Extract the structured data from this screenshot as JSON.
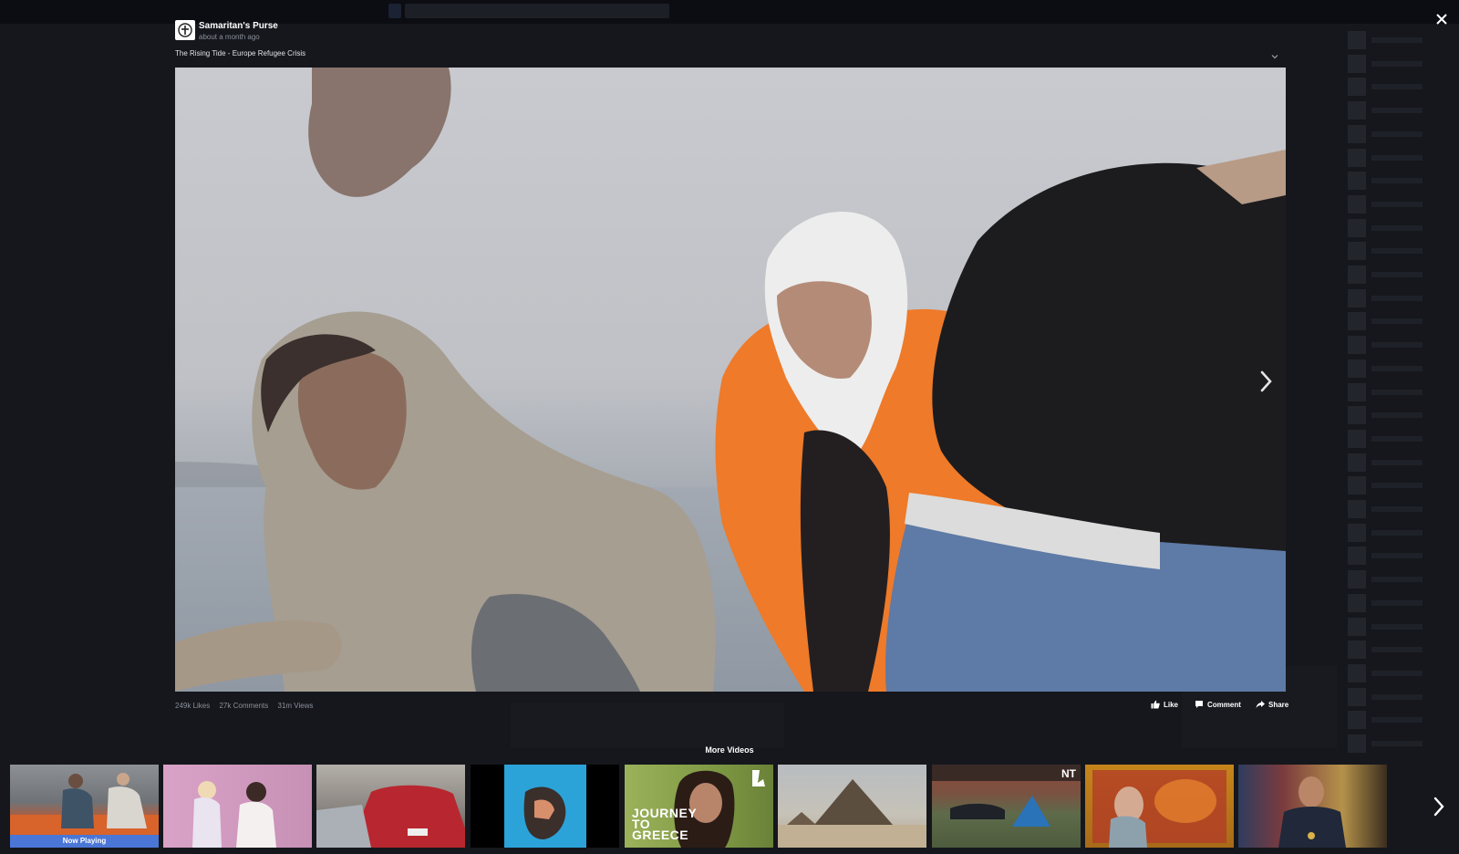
{
  "post": {
    "page_name": "Samaritan's Purse",
    "timestamp": "about a month ago",
    "video_title": "The Rising Tide - Europe Refugee Crisis"
  },
  "stats": {
    "likes": "249k Likes",
    "comments": "27k Comments",
    "views": "31m Views"
  },
  "actions": {
    "like": "Like",
    "comment": "Comment",
    "share": "Share"
  },
  "more_videos": {
    "heading": "More Videos",
    "now_playing_label": "Now Playing",
    "thumbnails": [
      {
        "caption": ""
      },
      {
        "caption": ""
      },
      {
        "caption": ""
      },
      {
        "caption": ""
      },
      {
        "caption": "JOURNEY TO GREECE"
      },
      {
        "caption": ""
      },
      {
        "caption": ""
      },
      {
        "caption": ""
      },
      {
        "caption": ""
      }
    ]
  },
  "icons": {
    "close": "close-icon",
    "next": "chevron-right-icon",
    "like": "thumbs-up-icon",
    "comment": "comment-bubble-icon",
    "share": "share-arrow-icon",
    "options": "chevron-down-icon"
  },
  "colors": {
    "overlay_background": "#15171c",
    "now_playing_accent": "#4a76d6",
    "text_primary": "#ffffff",
    "text_muted": "#8b909b"
  }
}
